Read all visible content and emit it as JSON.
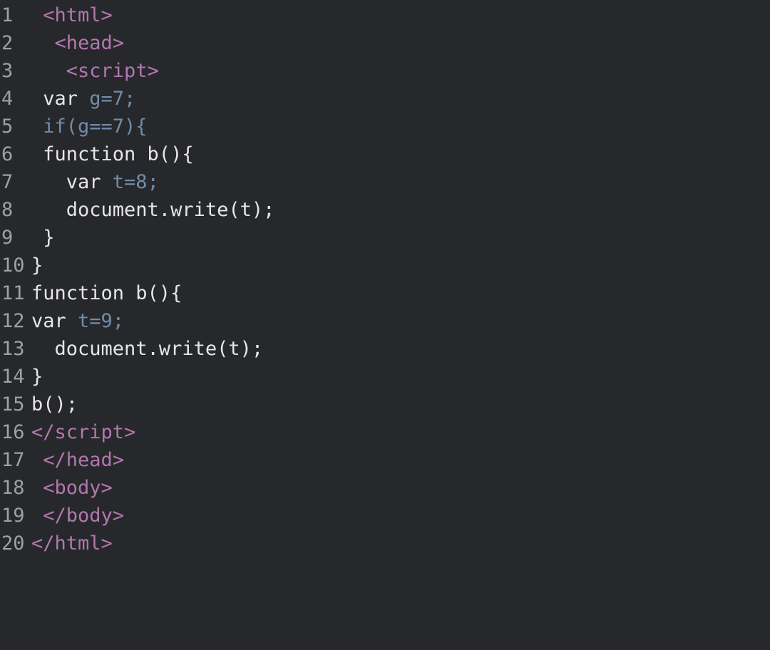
{
  "editor": {
    "theme": {
      "background": "#27282b",
      "foreground": "#e6e6e6",
      "gutter": "#9ea0a6",
      "tag": "#b277af",
      "keyword": "#6f8dab"
    },
    "lines": [
      {
        "n": "1",
        "tokens": [
          {
            "cls": "plain",
            "t": " "
          },
          {
            "cls": "tag",
            "t": "<html>"
          }
        ]
      },
      {
        "n": "2",
        "tokens": [
          {
            "cls": "plain",
            "t": "  "
          },
          {
            "cls": "tag",
            "t": "<head>"
          }
        ]
      },
      {
        "n": "3",
        "tokens": [
          {
            "cls": "plain",
            "t": "   "
          },
          {
            "cls": "tag",
            "t": "<script>"
          }
        ]
      },
      {
        "n": "4",
        "tokens": [
          {
            "cls": "plain",
            "t": " var "
          },
          {
            "cls": "kw",
            "t": "g=7;"
          }
        ]
      },
      {
        "n": "5",
        "tokens": [
          {
            "cls": "plain",
            "t": " "
          },
          {
            "cls": "kw",
            "t": "if(g==7){"
          }
        ]
      },
      {
        "n": "6",
        "tokens": [
          {
            "cls": "plain",
            "t": " function b(){"
          }
        ]
      },
      {
        "n": "7",
        "tokens": [
          {
            "cls": "plain",
            "t": "   var "
          },
          {
            "cls": "kw",
            "t": "t=8;"
          }
        ]
      },
      {
        "n": "8",
        "tokens": [
          {
            "cls": "plain",
            "t": "   document.write(t);"
          }
        ]
      },
      {
        "n": "9",
        "tokens": [
          {
            "cls": "plain",
            "t": " }"
          }
        ]
      },
      {
        "n": "10",
        "tokens": [
          {
            "cls": "plain",
            "t": "}"
          }
        ]
      },
      {
        "n": "11",
        "tokens": [
          {
            "cls": "plain",
            "t": "function b(){"
          }
        ]
      },
      {
        "n": "12",
        "tokens": [
          {
            "cls": "plain",
            "t": "var "
          },
          {
            "cls": "kw",
            "t": "t=9;"
          }
        ]
      },
      {
        "n": "13",
        "tokens": [
          {
            "cls": "plain",
            "t": "  document.write(t);"
          }
        ]
      },
      {
        "n": "14",
        "tokens": [
          {
            "cls": "plain",
            "t": "}"
          }
        ]
      },
      {
        "n": "15",
        "tokens": [
          {
            "cls": "plain",
            "t": "b();"
          }
        ]
      },
      {
        "n": "16",
        "tokens": [
          {
            "cls": "tag",
            "t": "</scr"
          },
          {
            "cls": "tag",
            "t": "ipt>"
          }
        ]
      },
      {
        "n": "17",
        "tokens": [
          {
            "cls": "plain",
            "t": " "
          },
          {
            "cls": "tag",
            "t": "</head>"
          }
        ]
      },
      {
        "n": "18",
        "tokens": [
          {
            "cls": "plain",
            "t": " "
          },
          {
            "cls": "tag",
            "t": "<body>"
          }
        ]
      },
      {
        "n": "19",
        "tokens": [
          {
            "cls": "plain",
            "t": " "
          },
          {
            "cls": "tag",
            "t": "</body>"
          }
        ]
      },
      {
        "n": "20",
        "tokens": [
          {
            "cls": "tag",
            "t": "</html>"
          }
        ]
      }
    ]
  }
}
